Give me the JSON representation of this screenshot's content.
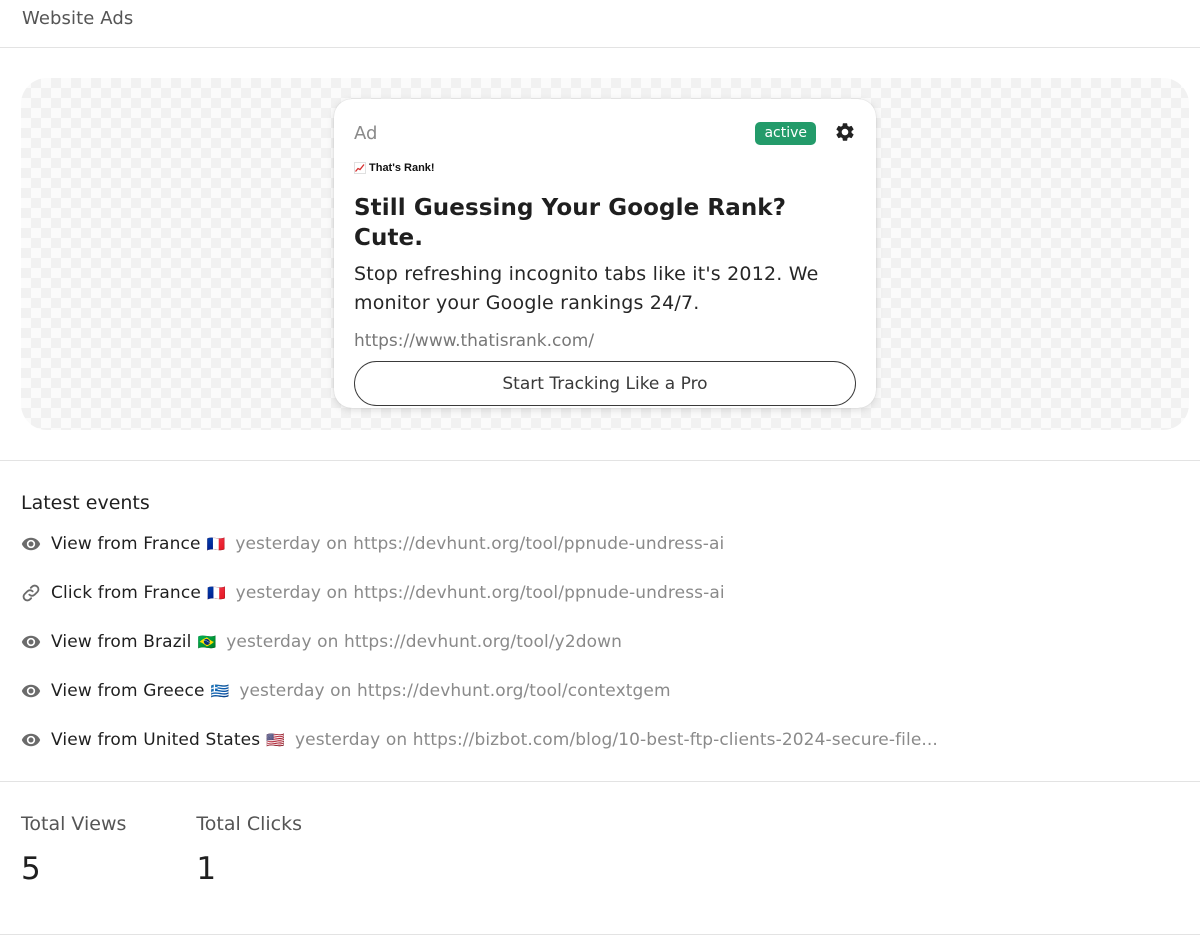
{
  "header": {
    "title": "Website Ads"
  },
  "ad": {
    "label": "Ad",
    "status": "active",
    "status_color": "#239b6a",
    "settings_icon": "gear-icon",
    "brand_icon": "chart-increasing-icon",
    "brand_name": "That's Rank!",
    "headline": "Still Guessing Your Google Rank? Cute.",
    "body": "Stop refreshing incognito tabs like it's 2012. We monitor your Google rankings 24/7.",
    "url": "https://www.thatisrank.com/",
    "cta": "Start Tracking Like a Pro"
  },
  "events": {
    "title": "Latest events",
    "items": [
      {
        "type": "view",
        "icon": "eye-icon",
        "label": "View from France",
        "flag": "🇫🇷",
        "meta": "yesterday on https://devhunt.org/tool/ppnude-undress-ai"
      },
      {
        "type": "click",
        "icon": "link-icon",
        "label": "Click from France",
        "flag": "🇫🇷",
        "meta": "yesterday on https://devhunt.org/tool/ppnude-undress-ai"
      },
      {
        "type": "view",
        "icon": "eye-icon",
        "label": "View from Brazil",
        "flag": "🇧🇷",
        "meta": "yesterday on https://devhunt.org/tool/y2down"
      },
      {
        "type": "view",
        "icon": "eye-icon",
        "label": "View from Greece",
        "flag": "🇬🇷",
        "meta": "yesterday on https://devhunt.org/tool/contextgem"
      },
      {
        "type": "view",
        "icon": "eye-icon",
        "label": "View from United States",
        "flag": "🇺🇸",
        "meta": "yesterday on https://bizbot.com/blog/10-best-ftp-clients-2024-secure-file..."
      }
    ]
  },
  "stats": {
    "views_label": "Total Views",
    "views_value": "5",
    "clicks_label": "Total Clicks",
    "clicks_value": "1"
  }
}
